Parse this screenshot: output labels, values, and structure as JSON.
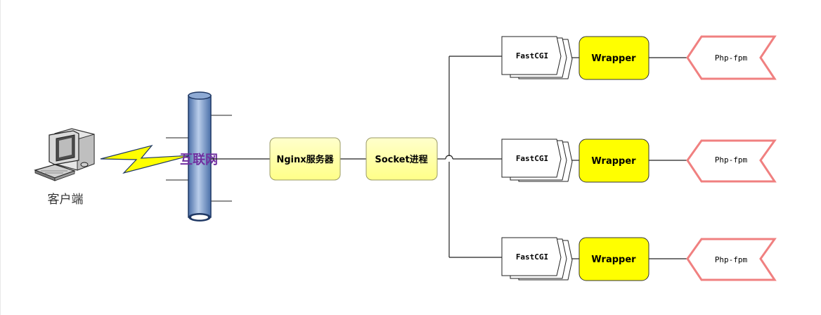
{
  "client": {
    "label": "客户端",
    "icon": "computer-icon"
  },
  "network": {
    "label": "互联网",
    "icon": "lightning-icon"
  },
  "nginx": {
    "label": "Nginx服务器"
  },
  "socket": {
    "label": "Socket进程"
  },
  "workers": [
    {
      "fastcgi": "FastCGI",
      "wrapper": "Wrapper",
      "fpm": "Php-fpm"
    },
    {
      "fastcgi": "FastCGI",
      "wrapper": "Wrapper",
      "fpm": "Php-fpm"
    },
    {
      "fastcgi": "FastCGI",
      "wrapper": "Wrapper",
      "fpm": "Php-fpm"
    }
  ],
  "colors": {
    "node_fill": "#ffff99",
    "wrapper_fill": "#ffff00",
    "fpm_stroke": "#f08080",
    "pipe_fill": "#8eaad4",
    "lightning_fill": "#ffff00",
    "internet_text": "#7030a0"
  }
}
